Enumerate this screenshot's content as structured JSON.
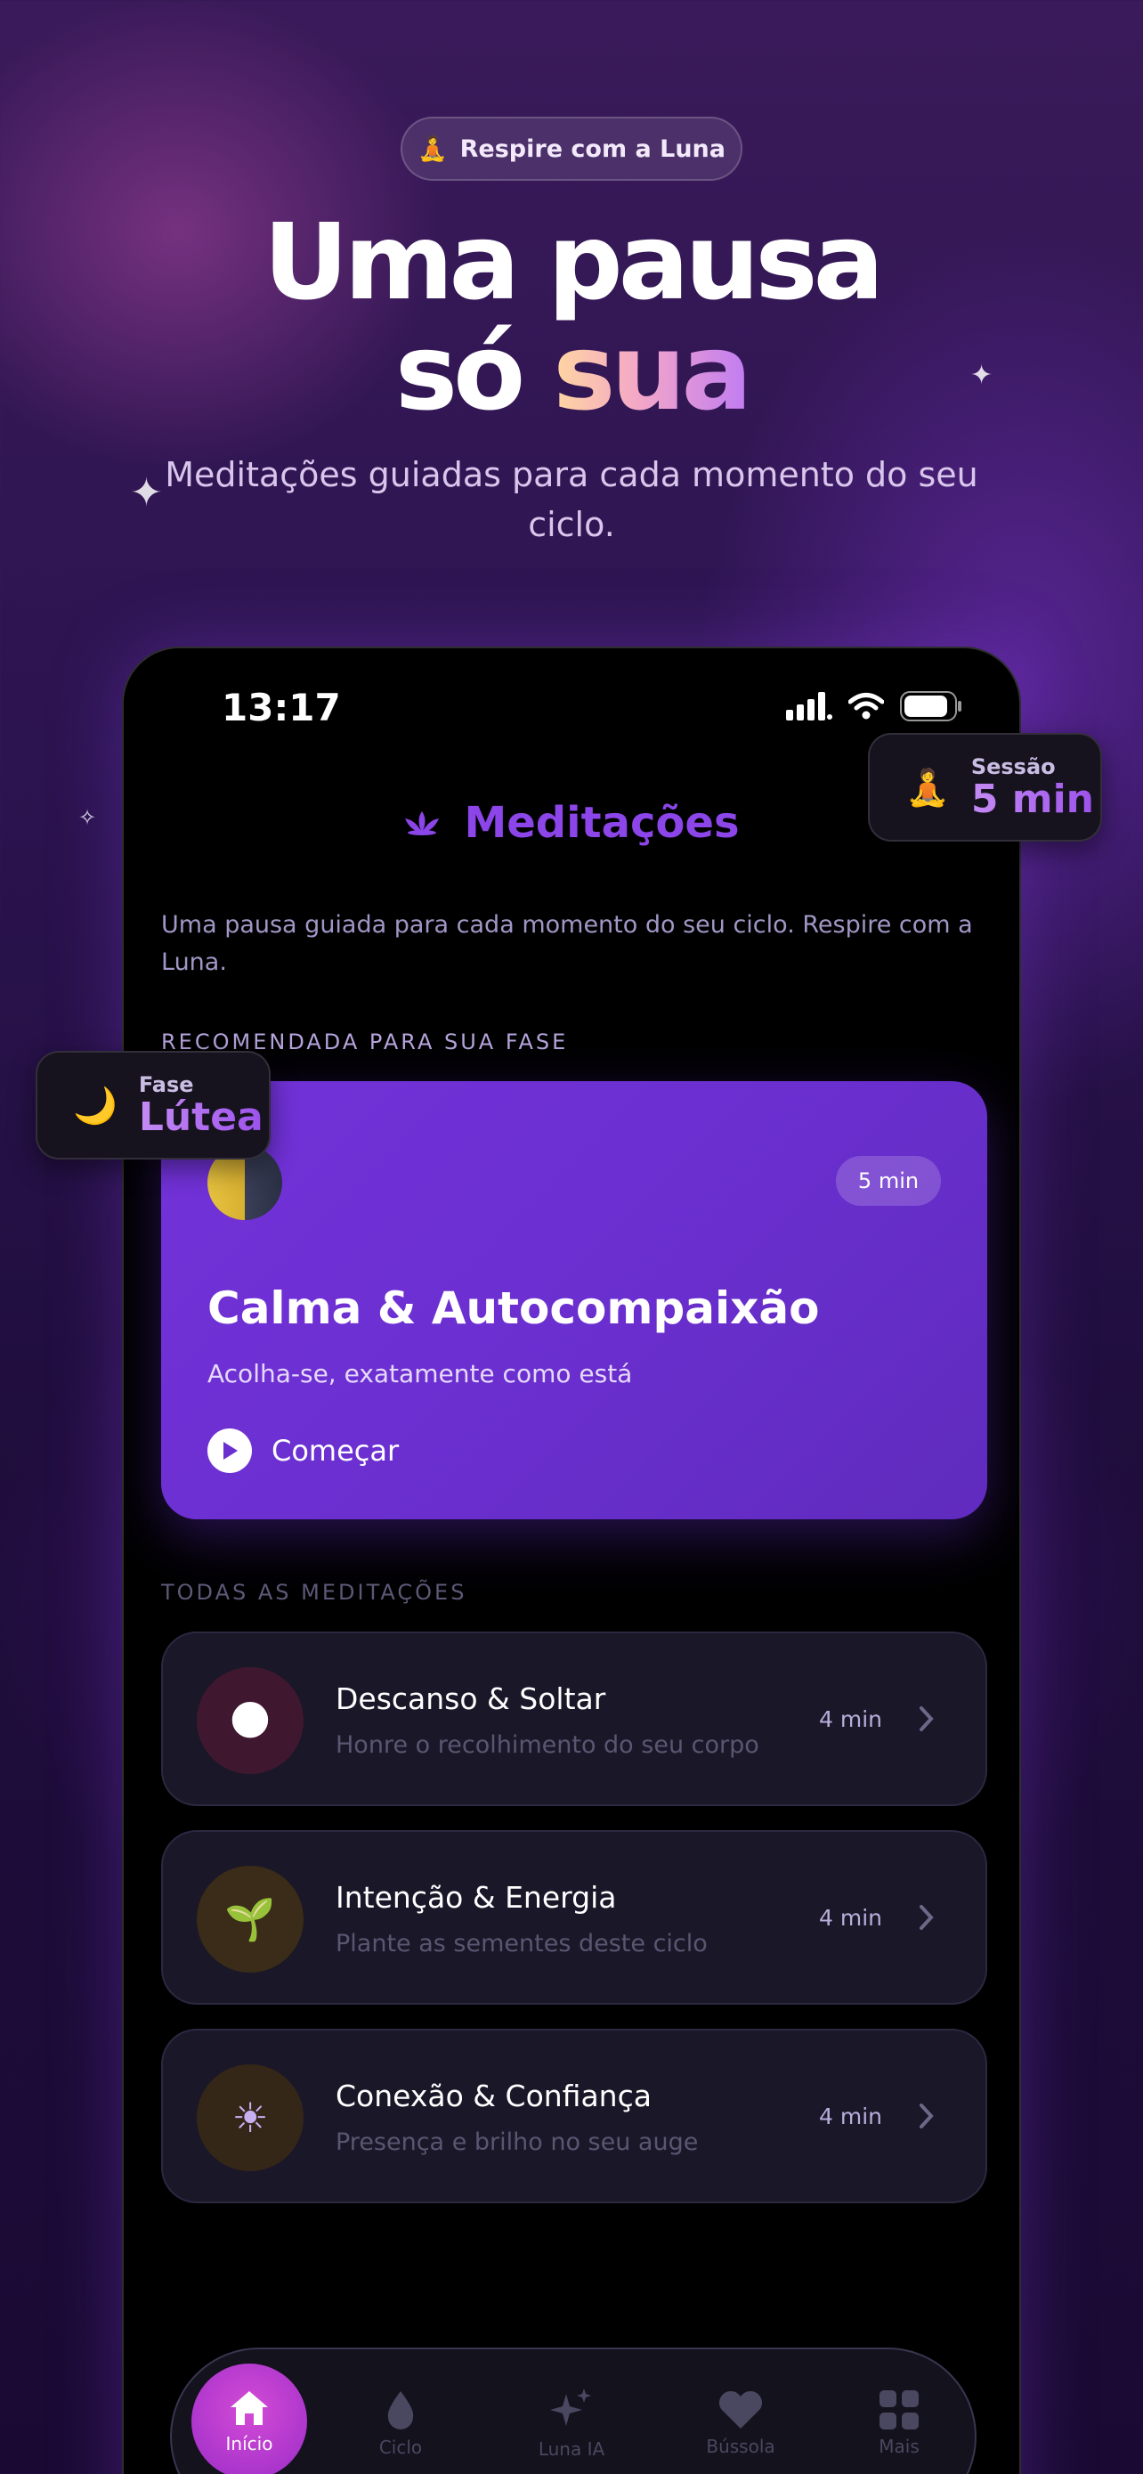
{
  "hero": {
    "badge_icon": "🧘",
    "badge_text": "Respire com a Luna",
    "headline_line1": "Uma pausa",
    "headline_line2_plain": "só ",
    "headline_line2_accent": "sua",
    "subtitle": "Meditações guiadas para cada momento do seu ciclo."
  },
  "status_bar": {
    "time": "13:17"
  },
  "app": {
    "title": "Meditações",
    "intro": "Uma pausa guiada para cada momento do seu ciclo. Respire com a Luna.",
    "recommended_label": "RECOMENDADA PARA SUA FASE",
    "all_label": "TODAS AS MEDITAÇÕES"
  },
  "featured": {
    "duration": "5 min",
    "title": "Calma & Autocompaixão",
    "subtitle": "Acolha-se, exatamente como está",
    "start_label": "Começar"
  },
  "meditations": [
    {
      "title": "Descanso & Soltar",
      "subtitle": "Honre o recolhimento do seu corpo",
      "duration": "4 min",
      "icon": "earth-icon",
      "glyph": "🌑",
      "color": "#4a1a3a"
    },
    {
      "title": "Intenção & Energia",
      "subtitle": "Plante as sementes deste ciclo",
      "duration": "4 min",
      "icon": "seedling-icon",
      "glyph": "🌱",
      "color": "#3d2f1c"
    },
    {
      "title": "Conexão & Confiança",
      "subtitle": "Presença e brilho no seu auge",
      "duration": "4 min",
      "icon": "sun-icon",
      "glyph": "☀",
      "color": "#3a2c22"
    }
  ],
  "float_session": {
    "label": "Sessão",
    "value": "5 min",
    "icon": "🧘"
  },
  "float_phase": {
    "label": "Fase",
    "value": "Lútea",
    "icon": "🌙"
  },
  "nav": {
    "items": [
      {
        "label": "Início",
        "icon": "home-icon"
      },
      {
        "label": "Ciclo",
        "icon": "drop-icon"
      },
      {
        "label": "Luna IA",
        "icon": "sparkles-icon"
      },
      {
        "label": "Bússola",
        "icon": "heart-icon"
      },
      {
        "label": "Mais",
        "icon": "grid-icon"
      }
    ]
  },
  "colors": {
    "accent": "#8b45e8",
    "feature_card": "#6b2fd0",
    "background": "#2c1450"
  }
}
